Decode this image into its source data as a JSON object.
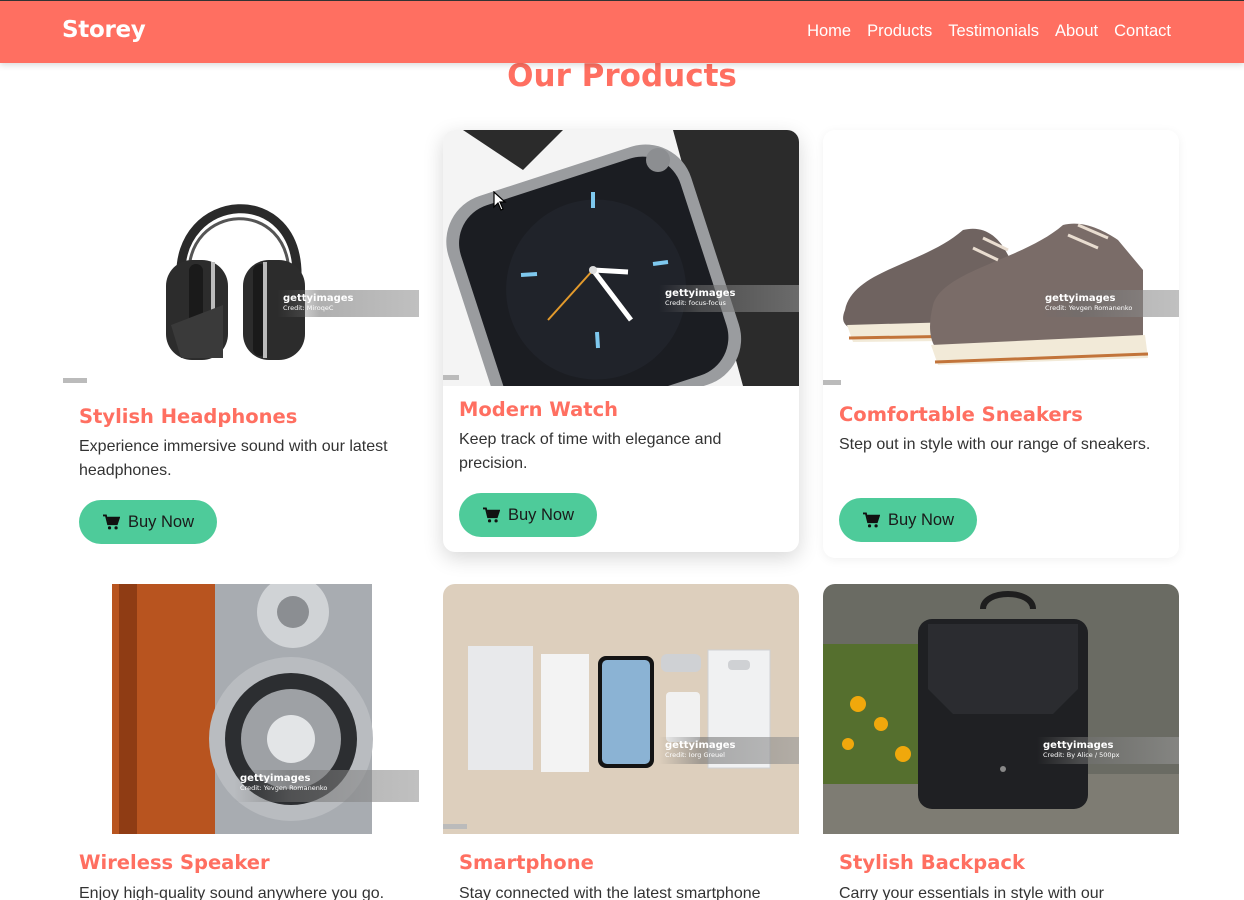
{
  "nav": {
    "brand": "Storey",
    "links": [
      "Home",
      "Products",
      "Testimonials",
      "About",
      "Contact"
    ]
  },
  "page_title": "Our Products",
  "watermark_logo": "gettyimages",
  "products": [
    {
      "title": "Stylish Headphones",
      "description": "Experience immersive sound with our latest headphones.",
      "button": "Buy Now",
      "credit": "Credit: MiroqeC",
      "icon": "headphones-icon"
    },
    {
      "title": "Modern Watch",
      "description": "Keep track of time with elegance and precision.",
      "button": "Buy Now",
      "credit": "Credit: focus-focus",
      "icon": "watch-icon"
    },
    {
      "title": "Comfortable Sneakers",
      "description": "Step out in style with our range of sneakers.",
      "button": "Buy Now",
      "credit": "Credit: Yevgen Romanenko",
      "icon": "sneakers-icon"
    },
    {
      "title": "Wireless Speaker",
      "description": "Enjoy high-quality sound anywhere you go.",
      "credit": "Credit: Yevgen Romanenko",
      "icon": "speaker-icon"
    },
    {
      "title": "Smartphone",
      "description": "Stay connected with the latest smartphone",
      "credit": "Credit: Iorg Greuel",
      "icon": "smartphone-icon"
    },
    {
      "title": "Stylish Backpack",
      "description": "Carry your essentials in style with our durable",
      "credit": "Credit: By Alice / 500px",
      "icon": "backpack-icon"
    }
  ],
  "colors": {
    "accent": "#ff6f61",
    "button": "#4ecb9a"
  }
}
